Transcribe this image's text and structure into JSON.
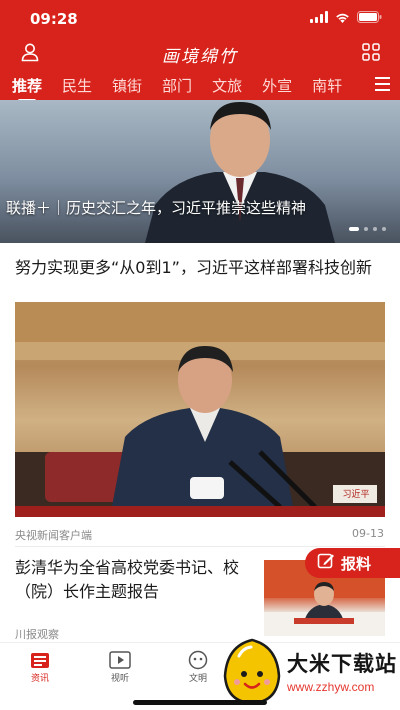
{
  "status_bar": {
    "time": "09:28"
  },
  "header": {
    "brand": "画境绵竹",
    "tabs": [
      "推荐",
      "民生",
      "镇街",
      "部门",
      "文旅",
      "外宣",
      "南轩"
    ],
    "active_tab": 0,
    "accent_color": "#d7231b"
  },
  "banner": {
    "caption": "联播＋｜历史交汇之年，习近平推崇这些精神",
    "slide_count": 4,
    "active_slide": 0
  },
  "articles": [
    {
      "title": "努力实现更多“从0到1”，习近平这样部署科技创新",
      "source": "央视新闻客户端",
      "date": "09-13",
      "image_placard": "习近平"
    },
    {
      "title": "彭清华为全省高校党委书记、校（院）长作主题报告",
      "source": "川报观察"
    }
  ],
  "report_button": {
    "label": "报料",
    "icon": "edit-icon"
  },
  "bottom_nav": [
    {
      "label": "资讯",
      "icon": "news-icon",
      "active": true
    },
    {
      "label": "视听",
      "icon": "video-icon",
      "active": false
    },
    {
      "label": "文明",
      "icon": "civility-icon",
      "active": false
    }
  ],
  "watermark": {
    "text": "大米下载站",
    "url": "www.zzhyw.com"
  }
}
